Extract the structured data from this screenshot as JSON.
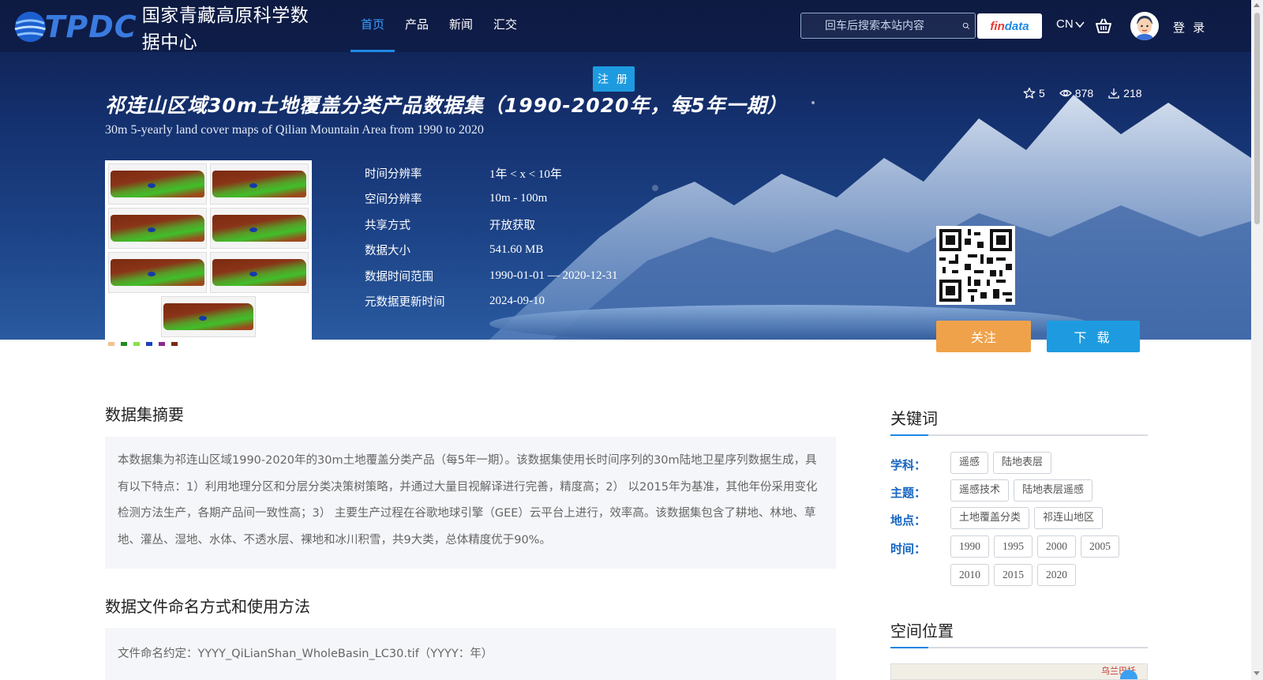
{
  "brand": {
    "letters": "TPDC",
    "name": "国家青藏高原科学数据中心"
  },
  "nav": [
    {
      "label": "首页",
      "active": true
    },
    {
      "label": "产品"
    },
    {
      "label": "新闻"
    },
    {
      "label": "汇交"
    }
  ],
  "search": {
    "placeholder": "回车后搜索本站内容"
  },
  "findata": {
    "part1": "fin",
    "part2": "data"
  },
  "lang": "CN",
  "login": "登 录",
  "register": "注 册",
  "dataset": {
    "title_cn": "祁连山区域30m土地覆盖分类产品数据集（1990-2020年，每5年一期）",
    "title_en": "30m 5-yearly land cover maps of Qilian Mountain Area from 1990 to 2020",
    "stats": {
      "stars": "5",
      "views": "878",
      "downloads": "218"
    },
    "meta": [
      {
        "key": "时间分辨率",
        "value": "1年 < x < 10年"
      },
      {
        "key": "空间分辨率",
        "value": "10m - 100m"
      },
      {
        "key": "共享方式",
        "value": "开放获取"
      },
      {
        "key": "数据大小",
        "value": "541.60 MB"
      },
      {
        "key": "数据时间范围",
        "value": "1990-01-01 — 2020-12-31"
      },
      {
        "key": "元数据更新时间",
        "value": "2024-09-10"
      }
    ]
  },
  "buttons": {
    "follow": "关注",
    "download": "下 载"
  },
  "abstract": {
    "title": "数据集摘要",
    "text": "本数据集为祁连山区域1990-2020年的30m土地覆盖分类产品（每5年一期）。该数据集使用长时间序列的30m陆地卫星序列数据生成，具有以下特点：1）利用地理分区和分层分类决策树策略，并通过大量目视解译进行完善，精度高；2） 以2015年为基准，其他年份采用变化检测方法生产，各期产品间一致性高；3） 主要生产过程在谷歌地球引擎（GEE）云平台上进行，效率高。该数据集包含了耕地、林地、草地、灌丛、湿地、水体、不透水层、裸地和冰川积雪，共9大类，总体精度优于90%。"
  },
  "naming": {
    "title": "数据文件命名方式和使用方法",
    "text": "文件命名约定：YYYY_QiLianShan_WholeBasin_LC30.tif（YYYY：年）"
  },
  "keywords": {
    "title": "关键词",
    "groups": [
      {
        "label": "学科：",
        "tags": [
          "遥感",
          "陆地表层"
        ]
      },
      {
        "label": "主题：",
        "tags": [
          "遥感技术",
          "陆地表层遥感"
        ]
      },
      {
        "label": "地点：",
        "tags": [
          "土地覆盖分类",
          "祁连山地区"
        ]
      },
      {
        "label": "时间：",
        "tags": [
          "1990",
          "1995",
          "2000",
          "2005",
          "2010",
          "2015",
          "2020"
        ]
      }
    ]
  },
  "spatial": {
    "title": "空间位置",
    "place": "乌兰巴托"
  }
}
